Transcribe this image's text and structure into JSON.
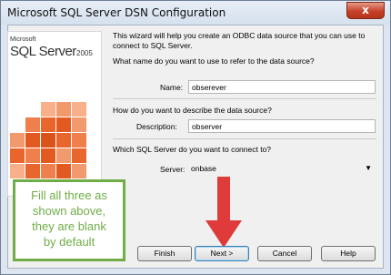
{
  "window": {
    "title": "Microsoft SQL Server DSN Configuration",
    "close_label": "x"
  },
  "logo": {
    "microsoft": "Microsoft",
    "sql_server": "SQL Server",
    "year": "2005"
  },
  "intro": {
    "line1": "This wizard will help you create an ODBC data source that you can use to",
    "line2": "connect to SQL Server."
  },
  "name_section": {
    "question": "What name do you want to use to refer to the data source?",
    "label": "Name:",
    "value": "obserever"
  },
  "description_section": {
    "question": "How do you want to describe the data source?",
    "label": "Description:",
    "value": "observer"
  },
  "server_section": {
    "question": "Which SQL Server do you want to connect to?",
    "label": "Server:",
    "value": "onbase"
  },
  "buttons": {
    "finish": "Finish",
    "next": "Next >",
    "cancel": "Cancel",
    "help": "Help"
  },
  "annotation": {
    "lines": [
      "Fill all three as",
      "shown above,",
      "they are blank",
      "by default"
    ],
    "border_color": "#70ad47",
    "arrow_color": "#e03b3b"
  }
}
